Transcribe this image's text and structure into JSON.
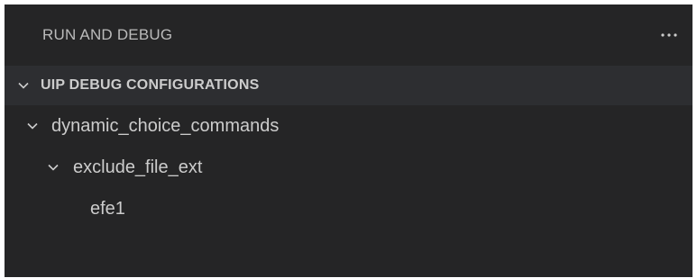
{
  "panel": {
    "title": "RUN AND DEBUG",
    "more_icon": "ellipsis-icon"
  },
  "section": {
    "title": "UIP DEBUG CONFIGURATIONS",
    "expanded": true,
    "icon": "chevron-down-icon"
  },
  "tree": {
    "items": [
      {
        "label": "dynamic_choice_commands",
        "expanded": true,
        "icon": "chevron-down-icon"
      },
      {
        "label": "exclude_file_ext",
        "expanded": true,
        "icon": "chevron-down-icon"
      },
      {
        "label": "efe1"
      }
    ]
  },
  "colors": {
    "background": "#252526",
    "section_background": "#2d2e31",
    "text": "#cccccc"
  }
}
